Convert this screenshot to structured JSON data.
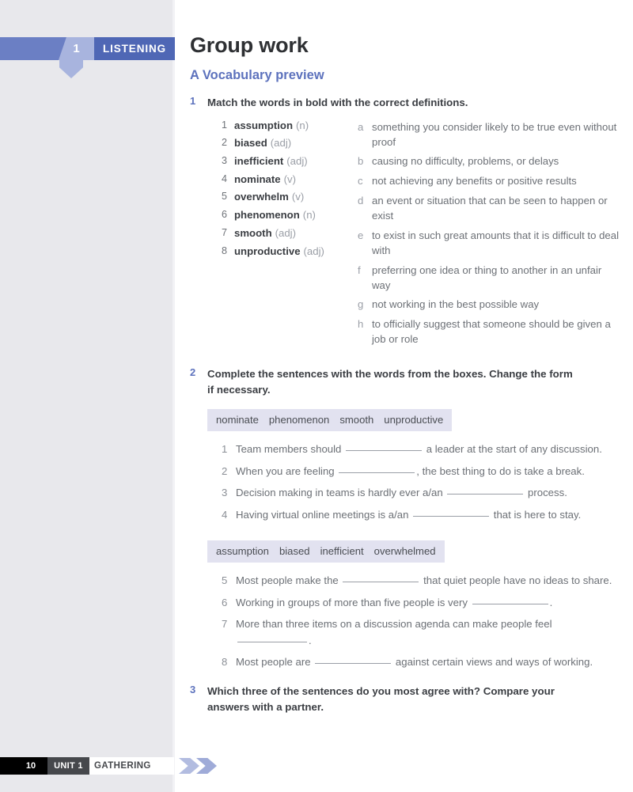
{
  "banner": {
    "number": "1",
    "label": "LISTENING"
  },
  "header": {
    "title": "Group work",
    "section": "A Vocabulary preview"
  },
  "exercise1": {
    "number": "1",
    "instruction": "Match the words in bold with the correct definitions.",
    "words": [
      {
        "idx": "1",
        "word": "assumption",
        "pos": "(n)"
      },
      {
        "idx": "2",
        "word": "biased",
        "pos": "(adj)"
      },
      {
        "idx": "3",
        "word": "inefficient",
        "pos": "(adj)"
      },
      {
        "idx": "4",
        "word": "nominate",
        "pos": "(v)"
      },
      {
        "idx": "5",
        "word": "overwhelm",
        "pos": "(v)"
      },
      {
        "idx": "6",
        "word": "phenomenon",
        "pos": "(n)"
      },
      {
        "idx": "7",
        "word": "smooth",
        "pos": "(adj)"
      },
      {
        "idx": "8",
        "word": "unproductive",
        "pos": "(adj)"
      }
    ],
    "definitions": [
      {
        "idx": "a",
        "text": "something you consider likely to be true even without proof"
      },
      {
        "idx": "b",
        "text": "causing no difficulty, problems, or delays"
      },
      {
        "idx": "c",
        "text": "not achieving any benefits or positive results"
      },
      {
        "idx": "d",
        "text": "an event or situation that can be seen to happen or exist"
      },
      {
        "idx": "e",
        "text": "to exist in such great amounts that it is difficult to deal with"
      },
      {
        "idx": "f",
        "text": "preferring one idea or thing to another in an unfair way"
      },
      {
        "idx": "g",
        "text": "not working in the best possible way"
      },
      {
        "idx": "h",
        "text": "to officially suggest that someone should be given a job or role"
      }
    ]
  },
  "exercise2": {
    "number": "2",
    "instruction": "Complete the sentences with the words from the boxes. Change the form if necessary.",
    "bank1": [
      "nominate",
      "phenomenon",
      "smooth",
      "unproductive"
    ],
    "bank2": [
      "assumption",
      "biased",
      "inefficient",
      "overwhelmed"
    ],
    "sentences_a": [
      {
        "idx": "1",
        "before": "Team members should",
        "after": "a leader at the start of any discussion."
      },
      {
        "idx": "2",
        "before": "When you are feeling",
        "after": ", the best thing to do is take a break."
      },
      {
        "idx": "3",
        "before": "Decision making in teams is hardly ever a/an",
        "after": "process."
      },
      {
        "idx": "4",
        "before": "Having virtual online meetings is a/an",
        "after": "that is here to stay."
      }
    ],
    "sentences_b": [
      {
        "idx": "5",
        "before": "Most people make the",
        "after": "that quiet people have no ideas to share."
      },
      {
        "idx": "6",
        "before": "Working in groups of more than five people is very",
        "after": "."
      },
      {
        "idx": "7",
        "before": "More than three items on a discussion agenda can make people feel",
        "after": "."
      },
      {
        "idx": "8",
        "before": "Most people are",
        "after": "against certain views and ways of working."
      }
    ]
  },
  "exercise3": {
    "number": "3",
    "instruction": "Which three of the sentences do you most agree with? Compare your answers with a partner."
  },
  "footer": {
    "page_number": "10",
    "unit_tag": "UNIT 1",
    "unit_name": "GATHERING"
  },
  "colors": {
    "accent_blue": "#5d72bd",
    "banner_dark": "#4f67b5",
    "banner_mid": "#6b7fc4",
    "banner_light": "#a8b4de",
    "word_bank_bg": "#e2e2f0",
    "margin_gray": "#e8e8ec"
  }
}
